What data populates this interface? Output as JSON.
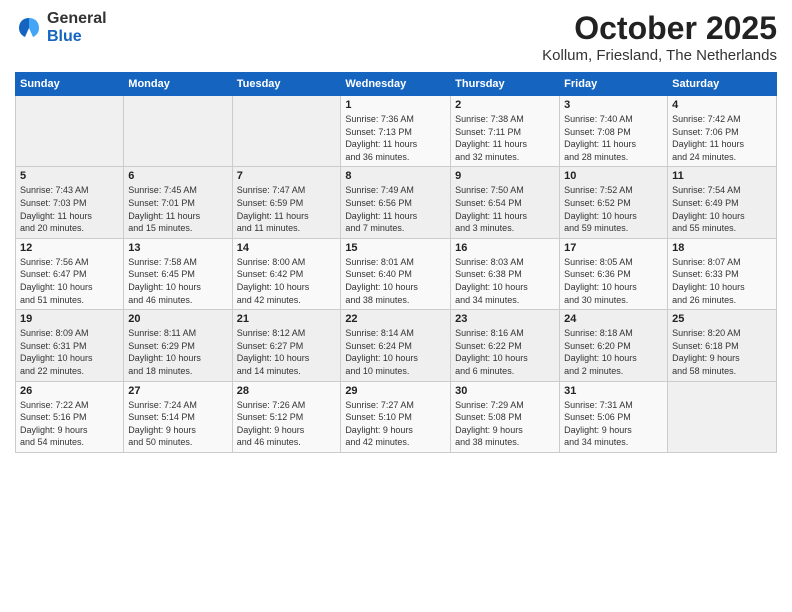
{
  "logo": {
    "general": "General",
    "blue": "Blue"
  },
  "title": "October 2025",
  "subtitle": "Kollum, Friesland, The Netherlands",
  "days_of_week": [
    "Sunday",
    "Monday",
    "Tuesday",
    "Wednesday",
    "Thursday",
    "Friday",
    "Saturday"
  ],
  "weeks": [
    [
      {
        "day": "",
        "info": ""
      },
      {
        "day": "",
        "info": ""
      },
      {
        "day": "",
        "info": ""
      },
      {
        "day": "1",
        "info": "Sunrise: 7:36 AM\nSunset: 7:13 PM\nDaylight: 11 hours\nand 36 minutes."
      },
      {
        "day": "2",
        "info": "Sunrise: 7:38 AM\nSunset: 7:11 PM\nDaylight: 11 hours\nand 32 minutes."
      },
      {
        "day": "3",
        "info": "Sunrise: 7:40 AM\nSunset: 7:08 PM\nDaylight: 11 hours\nand 28 minutes."
      },
      {
        "day": "4",
        "info": "Sunrise: 7:42 AM\nSunset: 7:06 PM\nDaylight: 11 hours\nand 24 minutes."
      }
    ],
    [
      {
        "day": "5",
        "info": "Sunrise: 7:43 AM\nSunset: 7:03 PM\nDaylight: 11 hours\nand 20 minutes."
      },
      {
        "day": "6",
        "info": "Sunrise: 7:45 AM\nSunset: 7:01 PM\nDaylight: 11 hours\nand 15 minutes."
      },
      {
        "day": "7",
        "info": "Sunrise: 7:47 AM\nSunset: 6:59 PM\nDaylight: 11 hours\nand 11 minutes."
      },
      {
        "day": "8",
        "info": "Sunrise: 7:49 AM\nSunset: 6:56 PM\nDaylight: 11 hours\nand 7 minutes."
      },
      {
        "day": "9",
        "info": "Sunrise: 7:50 AM\nSunset: 6:54 PM\nDaylight: 11 hours\nand 3 minutes."
      },
      {
        "day": "10",
        "info": "Sunrise: 7:52 AM\nSunset: 6:52 PM\nDaylight: 10 hours\nand 59 minutes."
      },
      {
        "day": "11",
        "info": "Sunrise: 7:54 AM\nSunset: 6:49 PM\nDaylight: 10 hours\nand 55 minutes."
      }
    ],
    [
      {
        "day": "12",
        "info": "Sunrise: 7:56 AM\nSunset: 6:47 PM\nDaylight: 10 hours\nand 51 minutes."
      },
      {
        "day": "13",
        "info": "Sunrise: 7:58 AM\nSunset: 6:45 PM\nDaylight: 10 hours\nand 46 minutes."
      },
      {
        "day": "14",
        "info": "Sunrise: 8:00 AM\nSunset: 6:42 PM\nDaylight: 10 hours\nand 42 minutes."
      },
      {
        "day": "15",
        "info": "Sunrise: 8:01 AM\nSunset: 6:40 PM\nDaylight: 10 hours\nand 38 minutes."
      },
      {
        "day": "16",
        "info": "Sunrise: 8:03 AM\nSunset: 6:38 PM\nDaylight: 10 hours\nand 34 minutes."
      },
      {
        "day": "17",
        "info": "Sunrise: 8:05 AM\nSunset: 6:36 PM\nDaylight: 10 hours\nand 30 minutes."
      },
      {
        "day": "18",
        "info": "Sunrise: 8:07 AM\nSunset: 6:33 PM\nDaylight: 10 hours\nand 26 minutes."
      }
    ],
    [
      {
        "day": "19",
        "info": "Sunrise: 8:09 AM\nSunset: 6:31 PM\nDaylight: 10 hours\nand 22 minutes."
      },
      {
        "day": "20",
        "info": "Sunrise: 8:11 AM\nSunset: 6:29 PM\nDaylight: 10 hours\nand 18 minutes."
      },
      {
        "day": "21",
        "info": "Sunrise: 8:12 AM\nSunset: 6:27 PM\nDaylight: 10 hours\nand 14 minutes."
      },
      {
        "day": "22",
        "info": "Sunrise: 8:14 AM\nSunset: 6:24 PM\nDaylight: 10 hours\nand 10 minutes."
      },
      {
        "day": "23",
        "info": "Sunrise: 8:16 AM\nSunset: 6:22 PM\nDaylight: 10 hours\nand 6 minutes."
      },
      {
        "day": "24",
        "info": "Sunrise: 8:18 AM\nSunset: 6:20 PM\nDaylight: 10 hours\nand 2 minutes."
      },
      {
        "day": "25",
        "info": "Sunrise: 8:20 AM\nSunset: 6:18 PM\nDaylight: 9 hours\nand 58 minutes."
      }
    ],
    [
      {
        "day": "26",
        "info": "Sunrise: 7:22 AM\nSunset: 5:16 PM\nDaylight: 9 hours\nand 54 minutes."
      },
      {
        "day": "27",
        "info": "Sunrise: 7:24 AM\nSunset: 5:14 PM\nDaylight: 9 hours\nand 50 minutes."
      },
      {
        "day": "28",
        "info": "Sunrise: 7:26 AM\nSunset: 5:12 PM\nDaylight: 9 hours\nand 46 minutes."
      },
      {
        "day": "29",
        "info": "Sunrise: 7:27 AM\nSunset: 5:10 PM\nDaylight: 9 hours\nand 42 minutes."
      },
      {
        "day": "30",
        "info": "Sunrise: 7:29 AM\nSunset: 5:08 PM\nDaylight: 9 hours\nand 38 minutes."
      },
      {
        "day": "31",
        "info": "Sunrise: 7:31 AM\nSunset: 5:06 PM\nDaylight: 9 hours\nand 34 minutes."
      },
      {
        "day": "",
        "info": ""
      }
    ]
  ]
}
